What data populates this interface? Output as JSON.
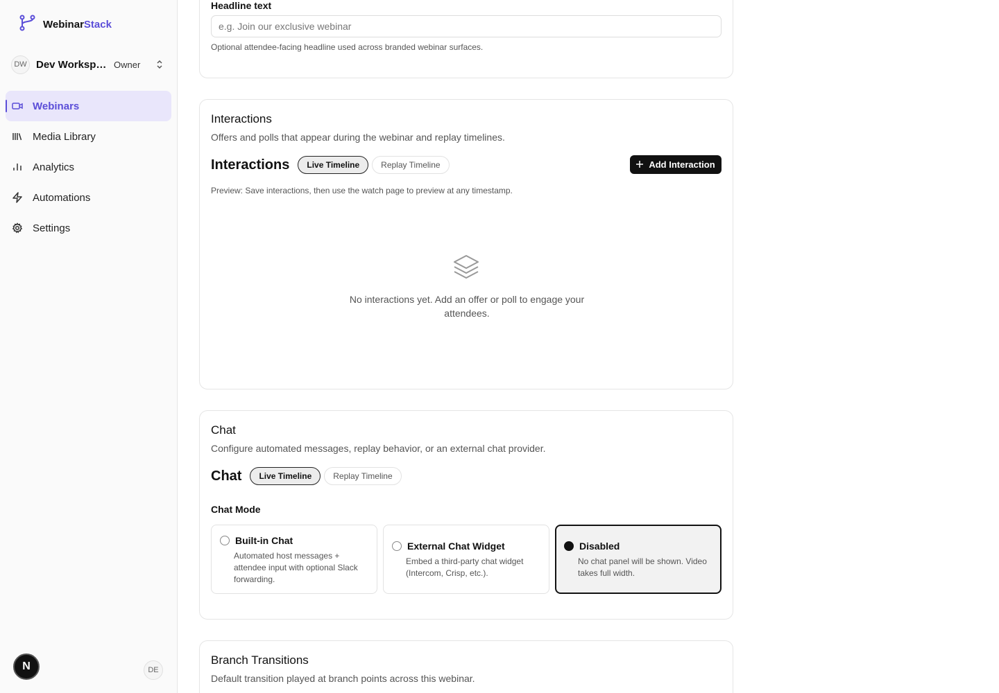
{
  "brand": {
    "name_part1": "Webinar",
    "name_part2": "Stack",
    "accent_color": "#5b4ed8"
  },
  "workspace": {
    "initials": "DW",
    "name": "Dev Workspa...",
    "role": "Owner"
  },
  "sidebar": {
    "items": [
      {
        "label": "Webinars",
        "icon": "video-icon",
        "active": true
      },
      {
        "label": "Media Library",
        "icon": "library-icon",
        "active": false
      },
      {
        "label": "Analytics",
        "icon": "bar-chart-icon",
        "active": false
      },
      {
        "label": "Automations",
        "icon": "lightning-icon",
        "active": false
      },
      {
        "label": "Settings",
        "icon": "gear-icon",
        "active": false
      }
    ],
    "badge": "N",
    "user_initials": "DE"
  },
  "headline": {
    "label": "Headline text",
    "placeholder": "e.g. Join our exclusive webinar",
    "value": "",
    "help": "Optional attendee-facing headline used across branded webinar surfaces."
  },
  "interactions": {
    "title": "Interactions",
    "subtitle": "Offers and polls that appear during the webinar and replay timelines.",
    "heading": "Interactions",
    "tabs": [
      {
        "label": "Live Timeline",
        "active": true
      },
      {
        "label": "Replay Timeline",
        "active": false
      }
    ],
    "add_button": "Add Interaction",
    "preview_note": "Preview: Save interactions, then use the watch page to preview at any timestamp.",
    "empty_text": "No interactions yet. Add an offer or poll to engage your attendees."
  },
  "chat": {
    "title": "Chat",
    "subtitle": "Configure automated messages, replay behavior, or an external chat provider.",
    "heading": "Chat",
    "tabs": [
      {
        "label": "Live Timeline",
        "active": true
      },
      {
        "label": "Replay Timeline",
        "active": false
      }
    ],
    "mode_label": "Chat Mode",
    "options": [
      {
        "title": "Built-in Chat",
        "description": "Automated host messages + attendee input with optional Slack forwarding.",
        "selected": false
      },
      {
        "title": "External Chat Widget",
        "description": "Embed a third-party chat widget (Intercom, Crisp, etc.).",
        "selected": false
      },
      {
        "title": "Disabled",
        "description": "No chat panel will be shown. Video takes full width.",
        "selected": true
      }
    ]
  },
  "branch": {
    "title": "Branch Transitions",
    "subtitle": "Default transition played at branch points across this webinar."
  }
}
